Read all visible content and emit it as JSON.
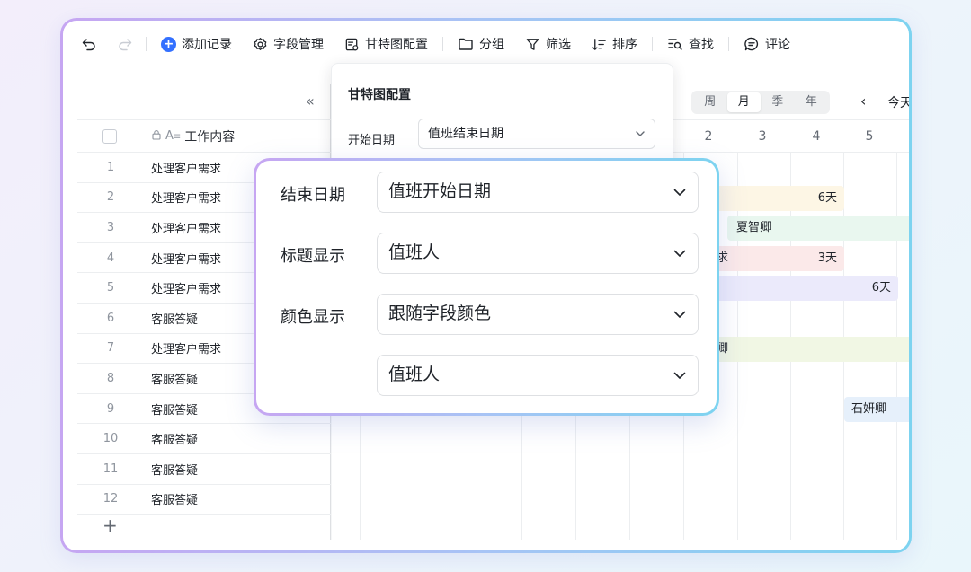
{
  "toolbar": {
    "add_record": "添加记录",
    "field_manage": "字段管理",
    "gantt_config": "甘特图配置",
    "group": "分组",
    "filter": "筛选",
    "sort": "排序",
    "find": "查找",
    "comment": "评论"
  },
  "grid": {
    "column_title": "工作内容",
    "rows": [
      {
        "num": "1",
        "text": "处理客户需求"
      },
      {
        "num": "2",
        "text": "处理客户需求"
      },
      {
        "num": "3",
        "text": "处理客户需求"
      },
      {
        "num": "4",
        "text": "处理客户需求"
      },
      {
        "num": "5",
        "text": "处理客户需求"
      },
      {
        "num": "6",
        "text": "客服答疑"
      },
      {
        "num": "7",
        "text": "处理客户需求"
      },
      {
        "num": "8",
        "text": "客服答疑"
      },
      {
        "num": "9",
        "text": "客服答疑"
      },
      {
        "num": "10",
        "text": "客服答疑"
      },
      {
        "num": "11",
        "text": "客服答疑"
      },
      {
        "num": "12",
        "text": "客服答疑"
      }
    ],
    "add_row": "+"
  },
  "gantt": {
    "scale": {
      "week": "周",
      "month": "月",
      "season": "季",
      "year": "年"
    },
    "today": "今天",
    "days": [
      "2",
      "3",
      "4",
      "5"
    ],
    "bars": {
      "b1": "6天",
      "b2": "夏智卿",
      "b3_partial": "求",
      "b3": "3天",
      "b4": "6天",
      "b5_partial": "卿",
      "b6": "石妍卿"
    }
  },
  "panel_small": {
    "title": "甘特图配置",
    "start_label": "开始日期",
    "start_value": "值班结束日期"
  },
  "panel_big": {
    "end_label": "结束日期",
    "end_value": "值班开始日期",
    "title_label": "标题显示",
    "title_value": "值班人",
    "color_label": "颜色显示",
    "color_value": "跟随字段颜色",
    "color_field_value": "值班人"
  },
  "colors": {
    "accent": "#3370ff",
    "bar_yellow": "#fdf6e5",
    "bar_green": "#e9f7ef",
    "bar_red": "#fbe9e9",
    "bar_purple": "#ebeafb",
    "bar_lime": "#f1f7e4",
    "bar_blue": "#e6f0fb"
  }
}
